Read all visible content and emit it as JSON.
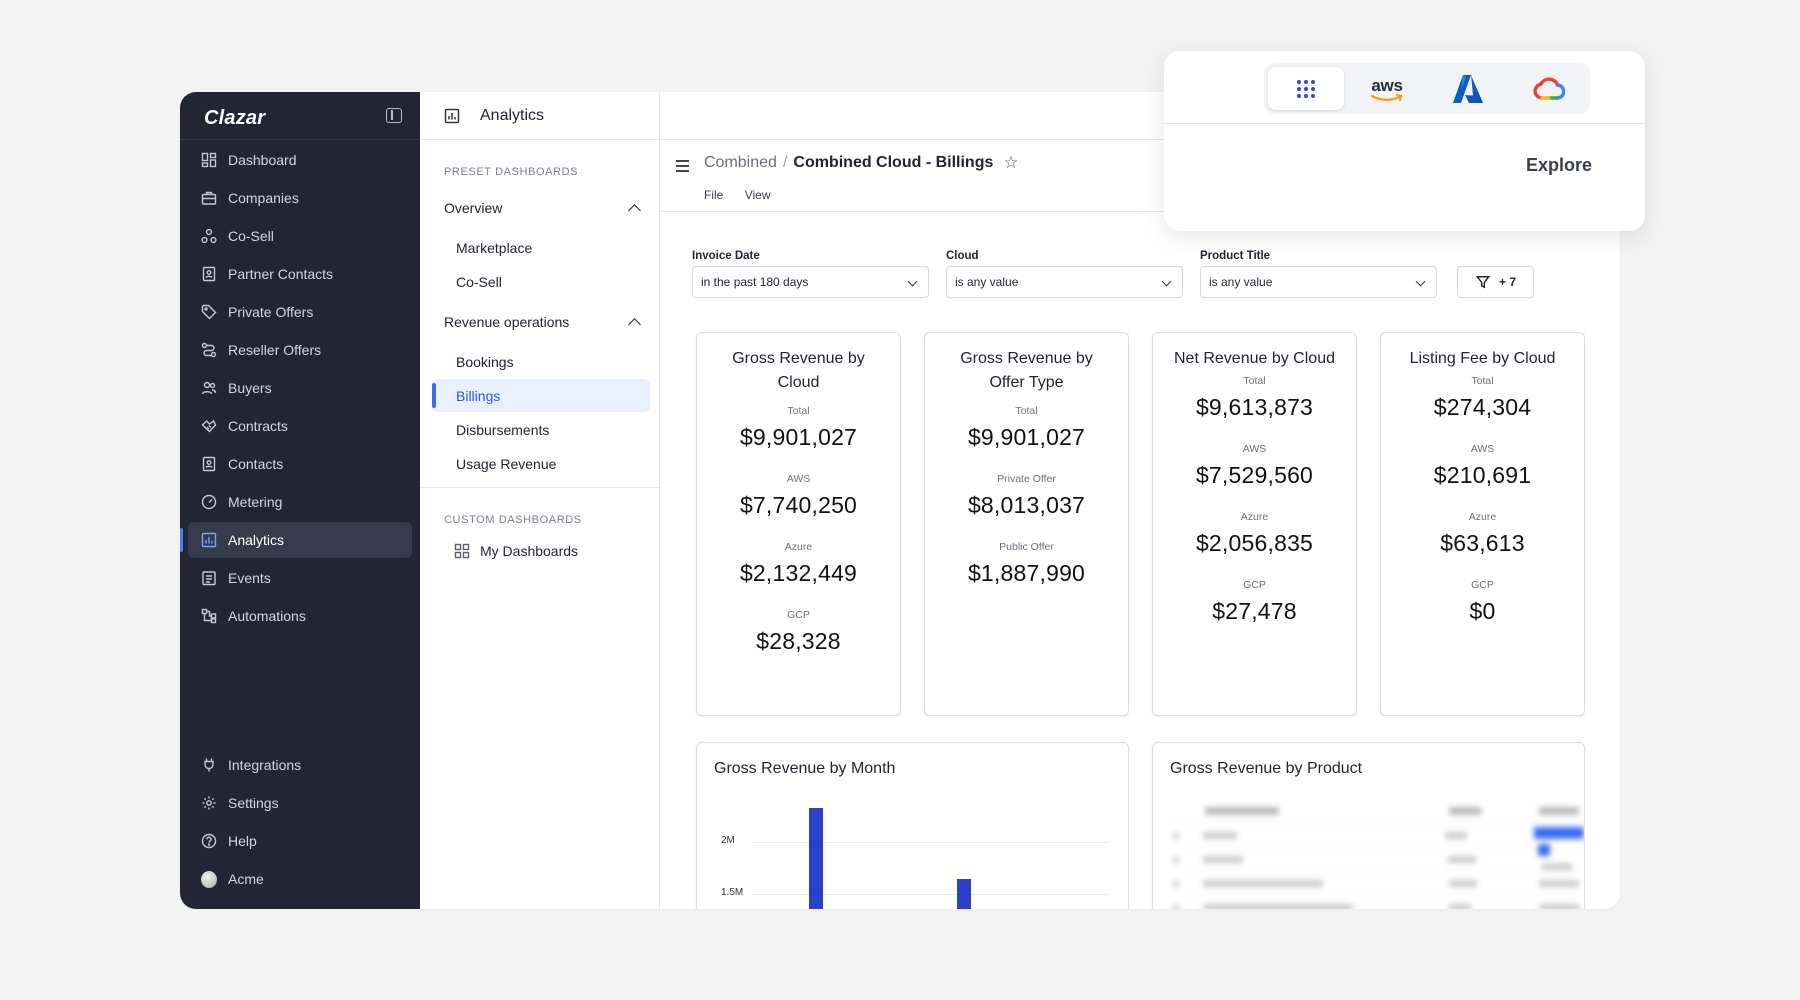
{
  "sidebar": {
    "brand": "Clazar",
    "items": [
      {
        "label": "Dashboard",
        "icon": "dashboard-icon"
      },
      {
        "label": "Companies",
        "icon": "briefcase-icon"
      },
      {
        "label": "Co-Sell",
        "icon": "co-sell-icon"
      },
      {
        "label": "Partner Contacts",
        "icon": "contact-book-icon"
      },
      {
        "label": "Private Offers",
        "icon": "tag-icon"
      },
      {
        "label": "Reseller Offers",
        "icon": "route-icon"
      },
      {
        "label": "Buyers",
        "icon": "users-icon"
      },
      {
        "label": "Contracts",
        "icon": "handshake-icon"
      },
      {
        "label": "Contacts",
        "icon": "contact-card-icon"
      },
      {
        "label": "Metering",
        "icon": "gauge-icon"
      },
      {
        "label": "Analytics",
        "icon": "analytics-icon",
        "active": true
      },
      {
        "label": "Events",
        "icon": "calendar-list-icon"
      },
      {
        "label": "Automations",
        "icon": "workflow-icon"
      }
    ],
    "bottom_items": [
      {
        "label": "Integrations",
        "icon": "plug-icon"
      },
      {
        "label": "Settings",
        "icon": "gear-icon"
      },
      {
        "label": "Help",
        "icon": "help-icon"
      },
      {
        "label": "Acme",
        "icon": "avatar"
      }
    ]
  },
  "topbar": {
    "title": "Analytics"
  },
  "subpanel": {
    "preset_header": "PRESET DASHBOARDS",
    "overview": {
      "label": "Overview",
      "items": [
        "Marketplace",
        "Co-Sell"
      ]
    },
    "revenue": {
      "label": "Revenue operations",
      "items": [
        "Bookings",
        "Billings",
        "Disbursements",
        "Usage Revenue"
      ],
      "active": "Billings"
    },
    "custom_header": "CUSTOM DASHBOARDS",
    "my_dashboards": "My Dashboards"
  },
  "main": {
    "breadcrumb": {
      "parent": "Combined",
      "separator": "/",
      "current": "Combined Cloud - Billings"
    },
    "menu": {
      "file": "File",
      "view": "View"
    },
    "filters": [
      {
        "label": "Invoice Date",
        "value": "in the past 180 days"
      },
      {
        "label": "Cloud",
        "value": "is any value"
      },
      {
        "label": "Product Title",
        "value": "is any value"
      }
    ],
    "more_filters": "+ 7"
  },
  "cards": [
    {
      "title": "Gross Revenue by Cloud",
      "stats": [
        {
          "label": "Total",
          "value": "$9,901,027"
        },
        {
          "label": "AWS",
          "value": "$7,740,250"
        },
        {
          "label": "Azure",
          "value": "$2,132,449"
        },
        {
          "label": "GCP",
          "value": "$28,328"
        }
      ]
    },
    {
      "title": "Gross Revenue by Offer Type",
      "stats": [
        {
          "label": "Total",
          "value": "$9,901,027"
        },
        {
          "label": "Private Offer",
          "value": "$8,013,037"
        },
        {
          "label": "Public Offer",
          "value": "$1,887,990"
        }
      ]
    },
    {
      "title": "Net Revenue by Cloud",
      "stats": [
        {
          "label": "Total",
          "value": "$9,613,873"
        },
        {
          "label": "AWS",
          "value": "$7,529,560"
        },
        {
          "label": "Azure",
          "value": "$2,056,835"
        },
        {
          "label": "GCP",
          "value": "$27,478"
        }
      ]
    },
    {
      "title": "Listing Fee by Cloud",
      "stats": [
        {
          "label": "Total",
          "value": "$274,304"
        },
        {
          "label": "AWS",
          "value": "$210,691"
        },
        {
          "label": "Azure",
          "value": "$63,613"
        },
        {
          "label": "GCP",
          "value": "$0"
        }
      ]
    }
  ],
  "panels": {
    "month": {
      "title": "Gross Revenue by Month",
      "y_ticks": [
        "2M",
        "1.5M"
      ]
    },
    "product": {
      "title": "Gross Revenue by Product"
    }
  },
  "chart_data": {
    "type": "bar",
    "title": "Gross Revenue by Month",
    "ylabel": "",
    "xlabel": "",
    "y_ticks": [
      2000000,
      1500000
    ],
    "values": [
      2330000,
      1640000
    ]
  },
  "popup": {
    "tabs": [
      {
        "name": "all-clouds-grid-icon",
        "active": true
      },
      {
        "name": "aws-logo",
        "text": "aws"
      },
      {
        "name": "azure-logo"
      },
      {
        "name": "google-cloud-logo"
      }
    ],
    "explore_label": "Explore"
  },
  "colors": {
    "sidebar_bg": "#222634",
    "accent": "#3b6cf0",
    "bar": "#2b3fc8"
  }
}
